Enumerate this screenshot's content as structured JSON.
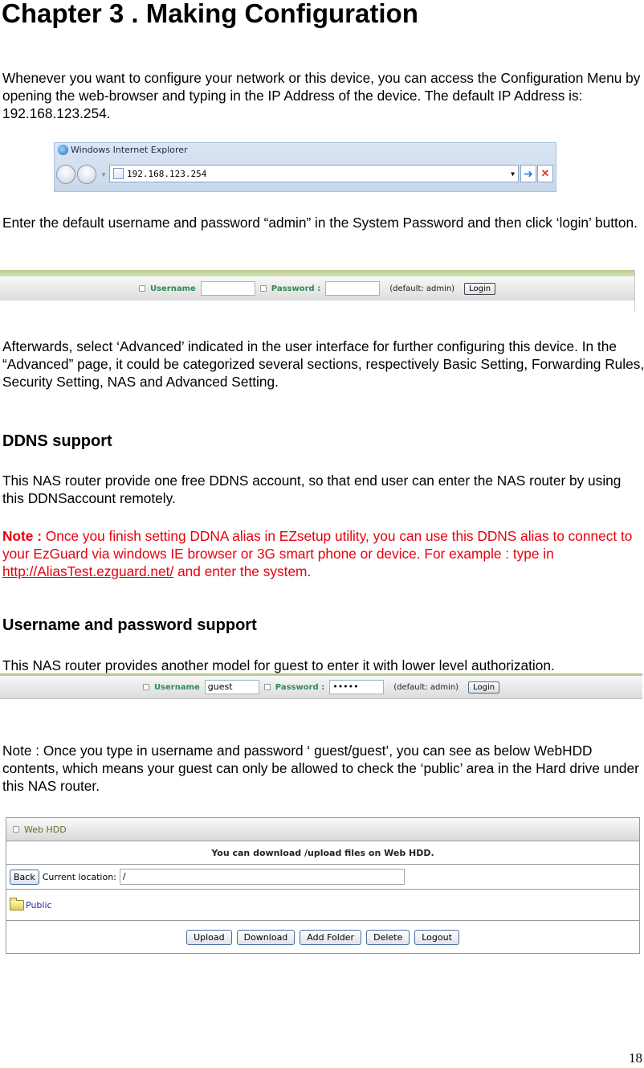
{
  "title": "Chapter 3 . Making Configuration",
  "intro": "Whenever you want to configure your network or this device, you can access the Configuration Menu by opening the web-browser and typing in the IP Address of the device. The default IP Address is: 192.168.123.254.",
  "ie_window": {
    "title": "Windows Internet Explorer",
    "address": "192.168.123.254",
    "icons": [
      "ie-logo-icon",
      "back-icon",
      "forward-icon",
      "go-arrow-icon",
      "stop-icon"
    ]
  },
  "login_instruction": "Enter the default username and password “admin” in the System Password and then click ‘login’ button.",
  "login_form_1": {
    "username_label": "Username",
    "username_value": "",
    "password_label": "Password :",
    "password_value": "",
    "hint": "(default: admin)",
    "login_label": "Login"
  },
  "advanced_text": "Afterwards, select ‘Advanced’ indicated in the user interface for further configuring this device. In the “Advanced” page, it could be categorized several sections, respectively Basic Setting, Forwarding Rules, Security Setting, NAS and Advanced Setting.",
  "ddns": {
    "heading": "DDNS support",
    "text": "This NAS router provide one free DDNS account, so that end user can enter the NAS router by using this DDNSaccount remotely.",
    "note_label": "Note :",
    "note_text_1": " Once you finish setting DDNA alias in EZsetup utility, you can use this DDNS alias to connect to your EzGuard via windows IE browser or 3G smart phone or device. For example : type in ",
    "note_link": "http://AliasTest.ezguard.net/",
    "note_text_2": " and enter the system."
  },
  "userpass": {
    "heading": "Username and password support",
    "text": "This NAS router provides another model for guest to enter it with lower level authorization.",
    "login_form_2": {
      "username_label": "Username",
      "username_value": "guest",
      "password_label": "Password :",
      "password_value": "•••••",
      "hint": "(default: admin)",
      "login_label": "Login"
    },
    "note": "Note : Once you type in username and password ‘ guest/guest’, you can see as below WebHDD contents, which means your guest can only be allowed to check the ‘public’ area in the Hard drive under this NAS router."
  },
  "webhdd": {
    "header": "Web HDD",
    "message": "You can download /upload files on Web HDD.",
    "back_label": "Back",
    "location_label": "Current location:",
    "location_value": "/",
    "folder": "Public",
    "buttons": [
      "Upload",
      "Download",
      "Add Folder",
      "Delete",
      "Logout"
    ]
  },
  "page_number": "18",
  "colors": {
    "note_red": "#e8000b",
    "login_label_green": "#2f8a5a"
  }
}
